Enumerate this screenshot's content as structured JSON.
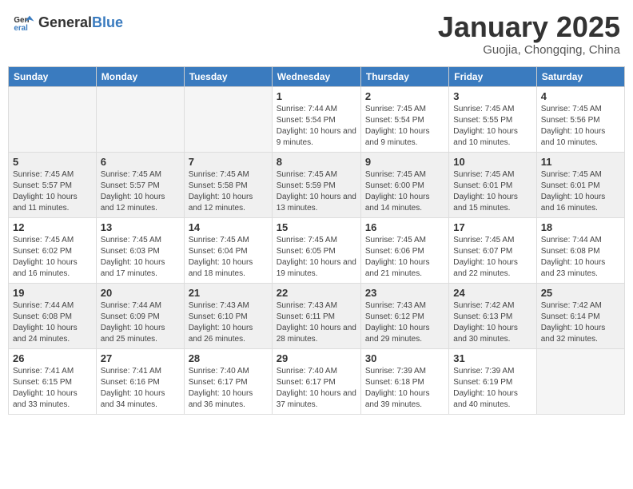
{
  "header": {
    "logo_general": "General",
    "logo_blue": "Blue",
    "title": "January 2025",
    "location": "Guojia, Chongqing, China"
  },
  "weekdays": [
    "Sunday",
    "Monday",
    "Tuesday",
    "Wednesday",
    "Thursday",
    "Friday",
    "Saturday"
  ],
  "weeks": [
    {
      "shaded": false,
      "days": [
        {
          "num": "",
          "info": ""
        },
        {
          "num": "",
          "info": ""
        },
        {
          "num": "",
          "info": ""
        },
        {
          "num": "1",
          "info": "Sunrise: 7:44 AM\nSunset: 5:54 PM\nDaylight: 10 hours and 9 minutes."
        },
        {
          "num": "2",
          "info": "Sunrise: 7:45 AM\nSunset: 5:54 PM\nDaylight: 10 hours and 9 minutes."
        },
        {
          "num": "3",
          "info": "Sunrise: 7:45 AM\nSunset: 5:55 PM\nDaylight: 10 hours and 10 minutes."
        },
        {
          "num": "4",
          "info": "Sunrise: 7:45 AM\nSunset: 5:56 PM\nDaylight: 10 hours and 10 minutes."
        }
      ]
    },
    {
      "shaded": true,
      "days": [
        {
          "num": "5",
          "info": "Sunrise: 7:45 AM\nSunset: 5:57 PM\nDaylight: 10 hours and 11 minutes."
        },
        {
          "num": "6",
          "info": "Sunrise: 7:45 AM\nSunset: 5:57 PM\nDaylight: 10 hours and 12 minutes."
        },
        {
          "num": "7",
          "info": "Sunrise: 7:45 AM\nSunset: 5:58 PM\nDaylight: 10 hours and 12 minutes."
        },
        {
          "num": "8",
          "info": "Sunrise: 7:45 AM\nSunset: 5:59 PM\nDaylight: 10 hours and 13 minutes."
        },
        {
          "num": "9",
          "info": "Sunrise: 7:45 AM\nSunset: 6:00 PM\nDaylight: 10 hours and 14 minutes."
        },
        {
          "num": "10",
          "info": "Sunrise: 7:45 AM\nSunset: 6:01 PM\nDaylight: 10 hours and 15 minutes."
        },
        {
          "num": "11",
          "info": "Sunrise: 7:45 AM\nSunset: 6:01 PM\nDaylight: 10 hours and 16 minutes."
        }
      ]
    },
    {
      "shaded": false,
      "days": [
        {
          "num": "12",
          "info": "Sunrise: 7:45 AM\nSunset: 6:02 PM\nDaylight: 10 hours and 16 minutes."
        },
        {
          "num": "13",
          "info": "Sunrise: 7:45 AM\nSunset: 6:03 PM\nDaylight: 10 hours and 17 minutes."
        },
        {
          "num": "14",
          "info": "Sunrise: 7:45 AM\nSunset: 6:04 PM\nDaylight: 10 hours and 18 minutes."
        },
        {
          "num": "15",
          "info": "Sunrise: 7:45 AM\nSunset: 6:05 PM\nDaylight: 10 hours and 19 minutes."
        },
        {
          "num": "16",
          "info": "Sunrise: 7:45 AM\nSunset: 6:06 PM\nDaylight: 10 hours and 21 minutes."
        },
        {
          "num": "17",
          "info": "Sunrise: 7:45 AM\nSunset: 6:07 PM\nDaylight: 10 hours and 22 minutes."
        },
        {
          "num": "18",
          "info": "Sunrise: 7:44 AM\nSunset: 6:08 PM\nDaylight: 10 hours and 23 minutes."
        }
      ]
    },
    {
      "shaded": true,
      "days": [
        {
          "num": "19",
          "info": "Sunrise: 7:44 AM\nSunset: 6:08 PM\nDaylight: 10 hours and 24 minutes."
        },
        {
          "num": "20",
          "info": "Sunrise: 7:44 AM\nSunset: 6:09 PM\nDaylight: 10 hours and 25 minutes."
        },
        {
          "num": "21",
          "info": "Sunrise: 7:43 AM\nSunset: 6:10 PM\nDaylight: 10 hours and 26 minutes."
        },
        {
          "num": "22",
          "info": "Sunrise: 7:43 AM\nSunset: 6:11 PM\nDaylight: 10 hours and 28 minutes."
        },
        {
          "num": "23",
          "info": "Sunrise: 7:43 AM\nSunset: 6:12 PM\nDaylight: 10 hours and 29 minutes."
        },
        {
          "num": "24",
          "info": "Sunrise: 7:42 AM\nSunset: 6:13 PM\nDaylight: 10 hours and 30 minutes."
        },
        {
          "num": "25",
          "info": "Sunrise: 7:42 AM\nSunset: 6:14 PM\nDaylight: 10 hours and 32 minutes."
        }
      ]
    },
    {
      "shaded": false,
      "days": [
        {
          "num": "26",
          "info": "Sunrise: 7:41 AM\nSunset: 6:15 PM\nDaylight: 10 hours and 33 minutes."
        },
        {
          "num": "27",
          "info": "Sunrise: 7:41 AM\nSunset: 6:16 PM\nDaylight: 10 hours and 34 minutes."
        },
        {
          "num": "28",
          "info": "Sunrise: 7:40 AM\nSunset: 6:17 PM\nDaylight: 10 hours and 36 minutes."
        },
        {
          "num": "29",
          "info": "Sunrise: 7:40 AM\nSunset: 6:17 PM\nDaylight: 10 hours and 37 minutes."
        },
        {
          "num": "30",
          "info": "Sunrise: 7:39 AM\nSunset: 6:18 PM\nDaylight: 10 hours and 39 minutes."
        },
        {
          "num": "31",
          "info": "Sunrise: 7:39 AM\nSunset: 6:19 PM\nDaylight: 10 hours and 40 minutes."
        },
        {
          "num": "",
          "info": ""
        }
      ]
    }
  ]
}
